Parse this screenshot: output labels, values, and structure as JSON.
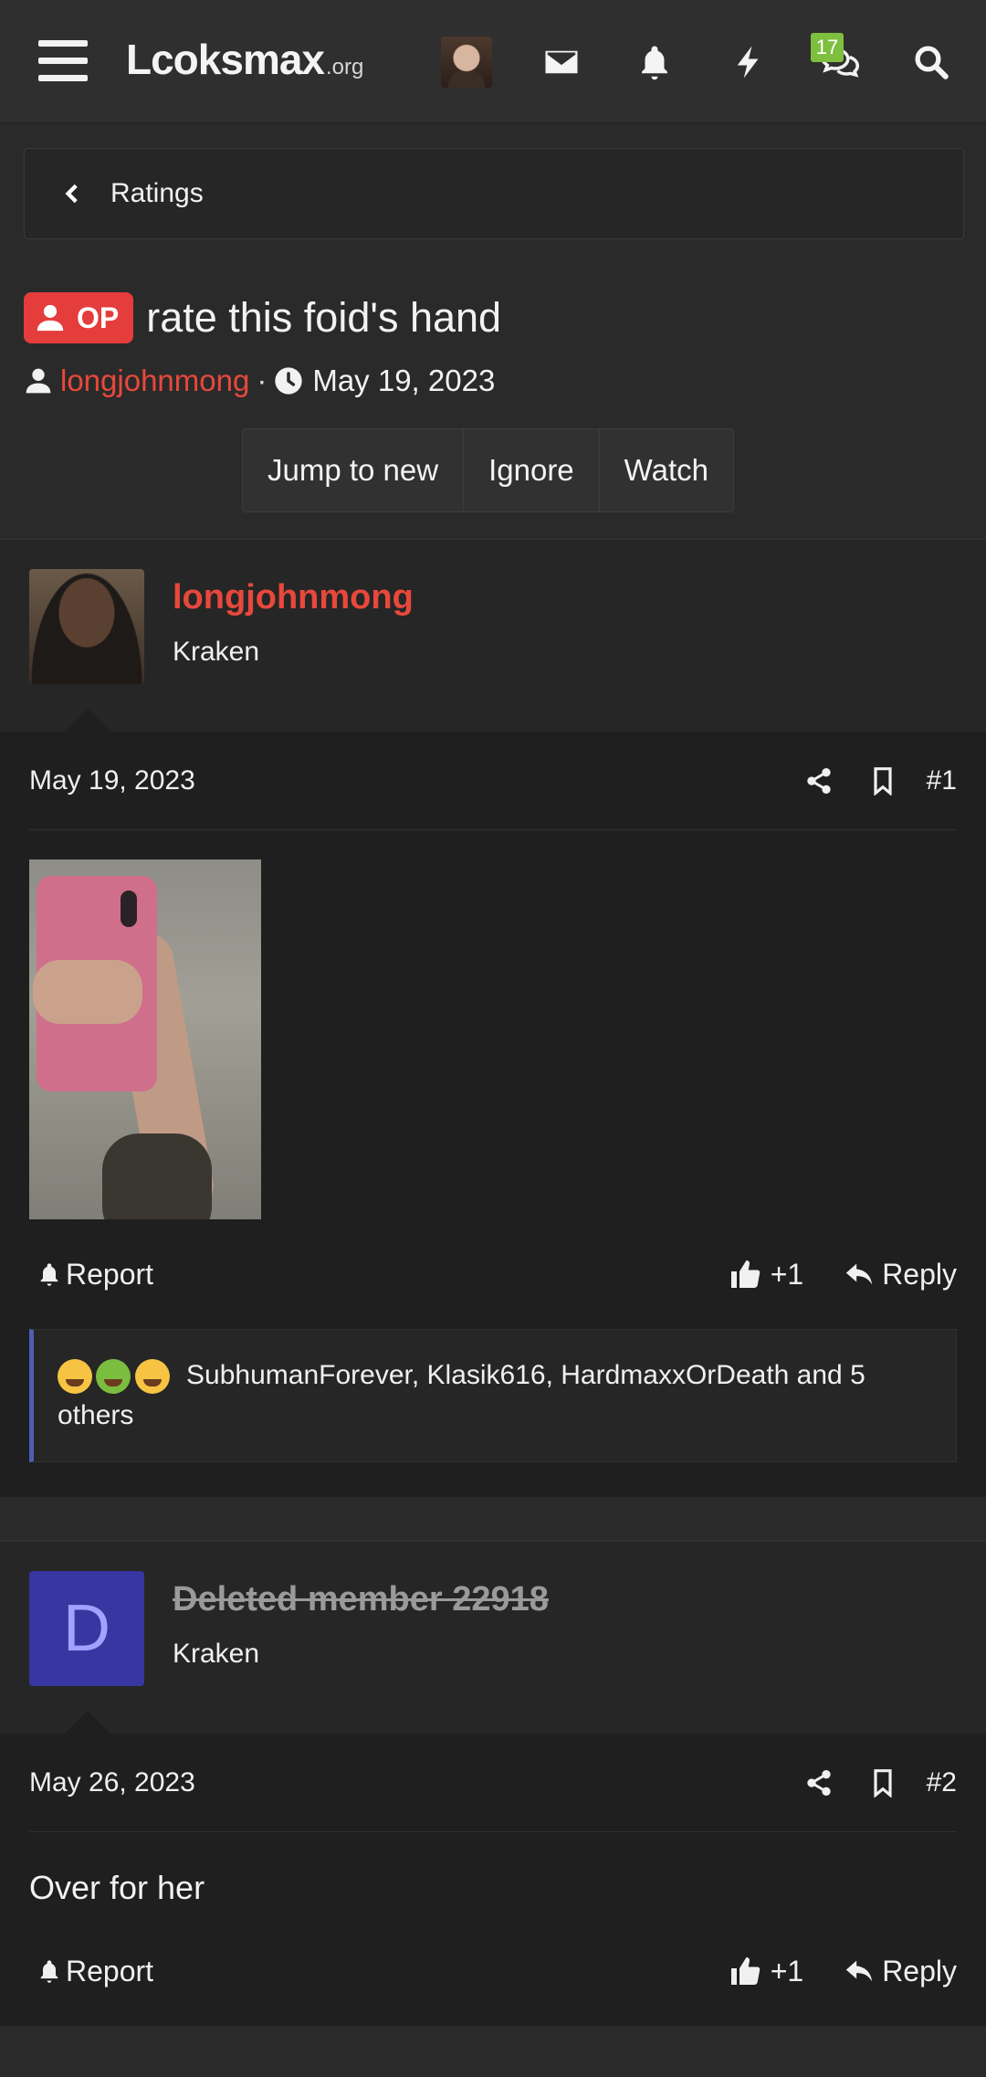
{
  "header": {
    "logo_main": "Lcoksmax",
    "logo_tld": ".org",
    "conversations_badge": "17",
    "icons": [
      "menu-icon",
      "envelope-icon",
      "bell-icon",
      "bolt-icon",
      "chat-icon",
      "search-icon"
    ]
  },
  "breadcrumb": {
    "label": "Ratings"
  },
  "thread": {
    "op_label": "OP",
    "title": "rate this foid's hand",
    "author": "longjohnmong",
    "separator": "·",
    "date": "May 19, 2023",
    "actions": [
      "Jump to new",
      "Ignore",
      "Watch"
    ]
  },
  "posts": [
    {
      "username": "longjohnmong",
      "rank": "Kraken",
      "date": "May 19, 2023",
      "number": "#1",
      "report_label": "Report",
      "like_label": "+1",
      "reply_label": "Reply",
      "reactions_text": "SubhumanForever, Klasik616, HardmaxxOrDeath and 5 others"
    },
    {
      "avatar_letter": "D",
      "username": "Deleted member 22918",
      "rank": "Kraken",
      "date": "May 26, 2023",
      "number": "#2",
      "text": "Over for her",
      "report_label": "Report",
      "like_label": "+1",
      "reply_label": "Reply"
    }
  ],
  "colors": {
    "accent_red": "#e8483c",
    "badge_green": "#7fbf3f",
    "reaction_border": "#4d5fb0",
    "deleted_avatar": "#3836a0"
  }
}
